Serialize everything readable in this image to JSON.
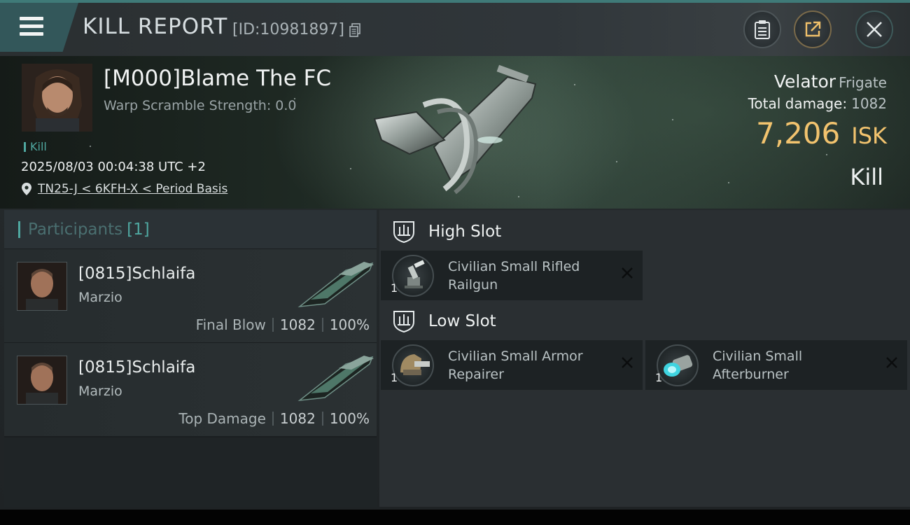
{
  "header": {
    "title": "KILL REPORT",
    "report_id": "[ID:10981897]"
  },
  "victim": {
    "name": "[M000]Blame The FC",
    "warp_scramble": "Warp Scramble Strength: 0.0",
    "kill_tag": "Kill",
    "datetime": "2025/08/03 00:04:38 UTC +2",
    "location": "TN25-J < 6KFH-X < Period Basis",
    "ship_name": "Velator",
    "ship_class": "Frigate",
    "total_damage_label": "Total damage:",
    "total_damage": "1082",
    "isk_value": "7,206",
    "isk_unit": "ISK",
    "result": "Kill"
  },
  "participants": {
    "title": "Participants",
    "count": "[1]",
    "rows": [
      {
        "name": "[0815]Schlaifa",
        "corp": "Marzio",
        "label": "Final Blow",
        "damage": "1082",
        "percent": "100%"
      },
      {
        "name": "[0815]Schlaifa",
        "corp": "Marzio",
        "label": "Top Damage",
        "damage": "1082",
        "percent": "100%"
      }
    ]
  },
  "fitting": {
    "high_slot": {
      "title": "High Slot",
      "modules": [
        {
          "name": "Civilian Small Rifled Railgun",
          "qty": "1"
        }
      ]
    },
    "low_slot": {
      "title": "Low Slot",
      "modules": [
        {
          "name": "Civilian Small Armor Repairer",
          "qty": "1"
        },
        {
          "name": "Civilian Small Afterburner",
          "qty": "1"
        }
      ]
    }
  },
  "icons": {
    "menu": "hamburger-menu-icon",
    "copy": "copy-icon",
    "clipboard": "clipboard-icon",
    "share": "share-icon",
    "close": "close-icon",
    "location": "location-pin-icon",
    "slot": "slot-shield-icon",
    "remove": "remove-x-icon"
  },
  "colors": {
    "accent_teal": "#4fa7a0",
    "isk_gold": "#f2c36e",
    "panel_dark": "#1f2426"
  }
}
